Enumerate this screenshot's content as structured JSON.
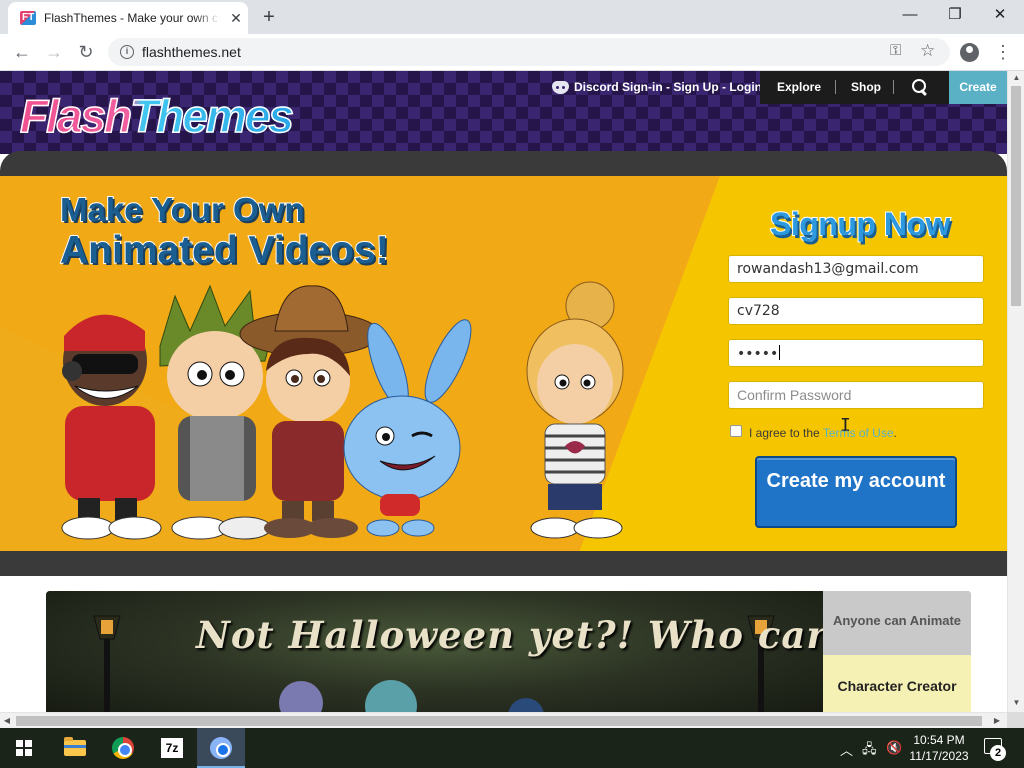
{
  "browser": {
    "tab_title": "FlashThemes - Make your own cartoons",
    "tab_favicon_text": "FT",
    "url": "flashthemes.net",
    "close_glyph": "✕",
    "new_tab_glyph": "+",
    "window_controls": {
      "minimize": "—",
      "maximize": "❐",
      "close": "✕"
    },
    "icons": [
      "back-icon",
      "forward-icon",
      "reload-icon",
      "info-icon",
      "key-icon",
      "star-icon",
      "profile-icon",
      "menu-icon"
    ]
  },
  "site": {
    "logo": "FlashThemes",
    "nav": {
      "discord": "Discord Sign-in - Sign Up - Login",
      "explore": "Explore",
      "shop": "Shop",
      "create": "Create"
    },
    "hero": {
      "headline_line1": "Make Your Own",
      "headline_line2": "Animated Videos!",
      "signup_title": "Signup Now",
      "email_value": "rowandash13@gmail.com",
      "username_value": "cv728",
      "password_value": "•••••",
      "confirm_placeholder": "Confirm Password",
      "agree_prefix": "I agree to the ",
      "terms_link": "Terms of Use",
      "agree_suffix": ".",
      "create_button": "Create my account"
    },
    "banner": {
      "title": "Not Halloween yet?! Who cares!!",
      "side_tab_1": "Anyone can Animate",
      "side_tab_2": "Character Creator"
    }
  },
  "taskbar": {
    "apps": [
      "windows-start",
      "file-explorer",
      "google-chrome",
      "7-zip",
      "chrome-active"
    ],
    "sevenzip_label": "7z",
    "time": "10:54 PM",
    "date": "11/17/2023",
    "notification_count": "2"
  },
  "colors": {
    "hero_yellow": "#f5c600",
    "hero_orange": "#f1a916",
    "button_blue": "#1f74c7",
    "create_teal": "#5ab1c6",
    "headline_blue": "#1b5f92"
  }
}
